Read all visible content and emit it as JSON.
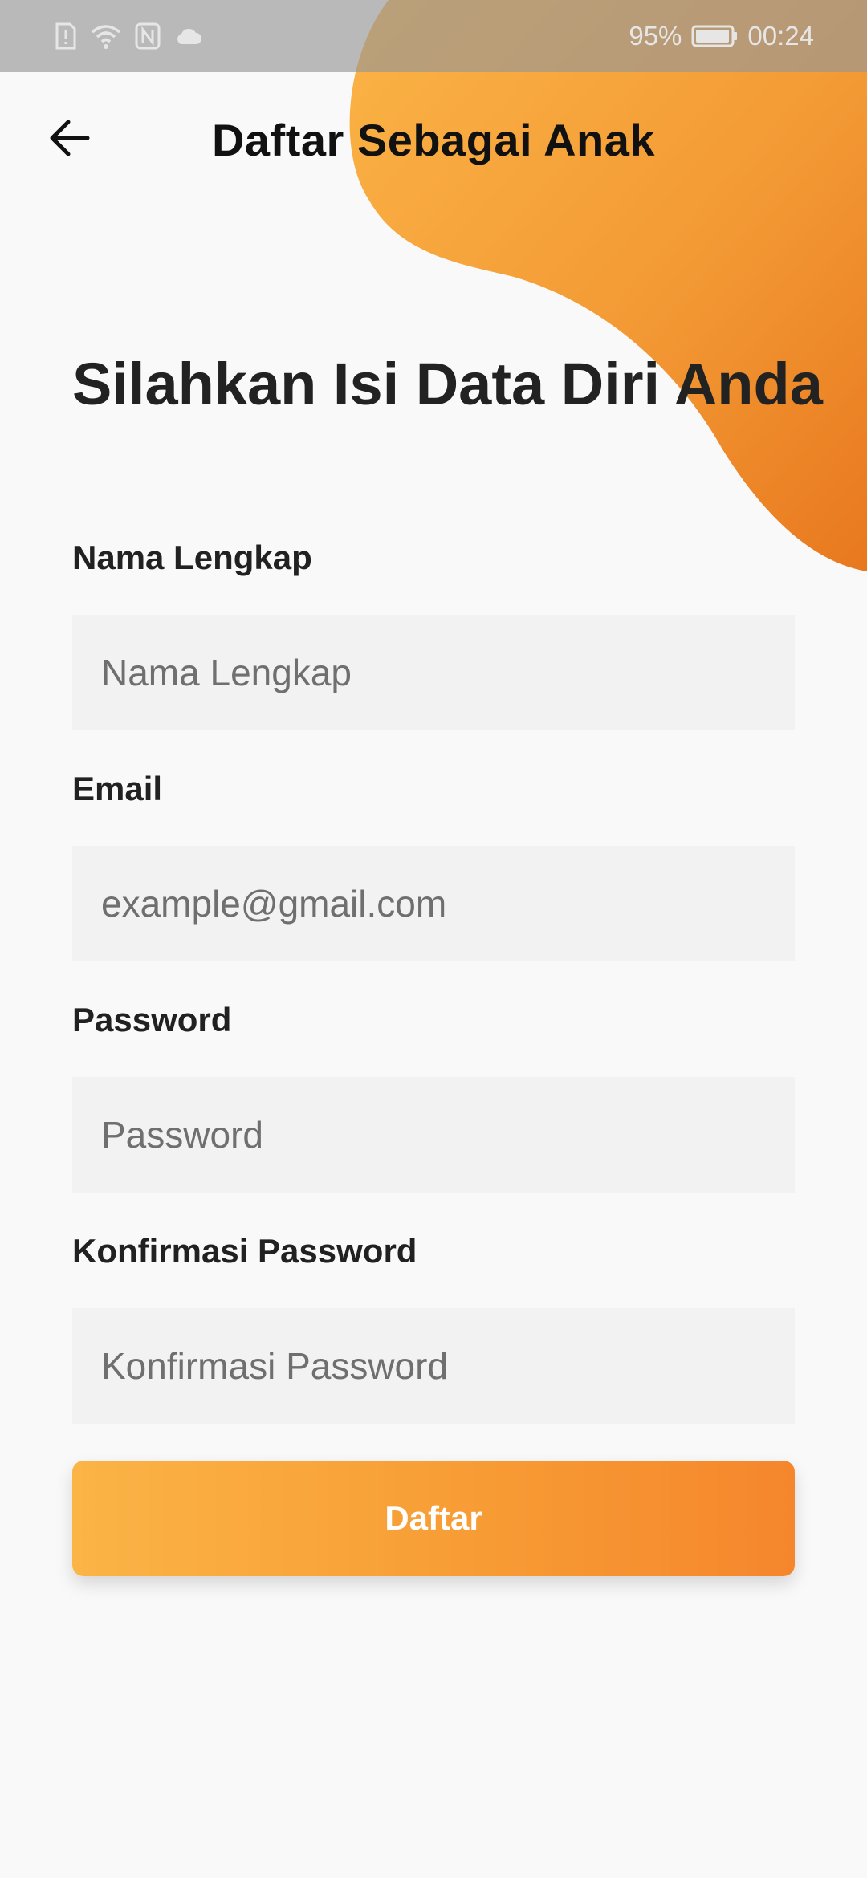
{
  "theme": {
    "accent_light": "#FBB446",
    "accent_dark": "#E8781E",
    "background": "#F9F9F9",
    "input_background": "#F2F2F2"
  },
  "status_bar": {
    "icons": [
      "sim-alert-icon",
      "wifi-icon",
      "nfc-icon",
      "cloud-icon",
      "battery-icon"
    ],
    "battery": "95%",
    "time": "00:24"
  },
  "app_bar": {
    "back_icon": "arrow-left-icon",
    "title": "Daftar Sebagai Anak"
  },
  "heading": "Silahkan Isi Data Diri Anda",
  "form": {
    "full_name": {
      "label": "Nama Lengkap",
      "placeholder": "Nama Lengkap",
      "value": ""
    },
    "email": {
      "label": "Email",
      "placeholder": "example@gmail.com",
      "value": ""
    },
    "password": {
      "label": "Password",
      "placeholder": "Password",
      "value": ""
    },
    "confirm_password": {
      "label": "Konfirmasi Password",
      "placeholder": "Konfirmasi Password",
      "value": ""
    },
    "submit_label": "Daftar"
  }
}
